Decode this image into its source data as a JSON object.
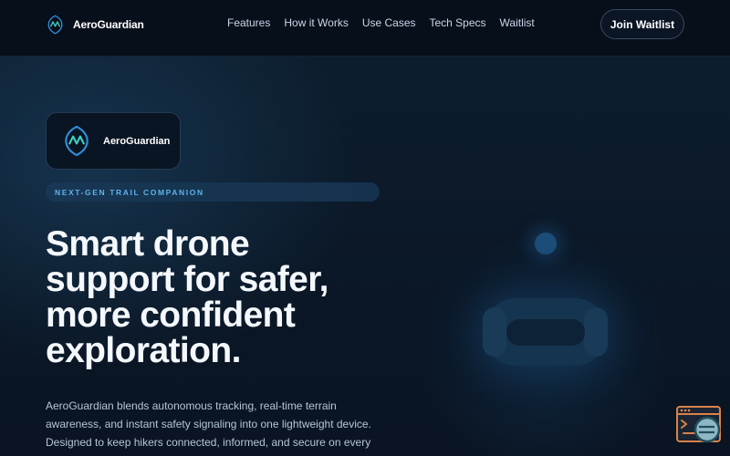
{
  "brand": {
    "name": "AeroGuardian",
    "logo_icon": "aeroguardian-logo-icon"
  },
  "nav": {
    "items": [
      {
        "label": "Features"
      },
      {
        "label": "How it Works"
      },
      {
        "label": "Use Cases"
      },
      {
        "label": "Tech Specs"
      },
      {
        "label": "Waitlist"
      }
    ],
    "cta_label": "Join Waitlist"
  },
  "hero": {
    "product_card_name": "AeroGuardian",
    "eyebrow": "NEXT-GEN TRAIL COMPANION",
    "headline": "Smart drone support for safer, more confident exploration.",
    "subtext": "AeroGuardian blends autonomous tracking, real-time terrain awareness, and instant safety signaling into one lightweight device. Designed to keep hikers connected, informed, and secure on every journey."
  },
  "colors": {
    "accent": "#5fb2ea",
    "background": "#0a1422",
    "logo_blue": "#2f8fd8",
    "logo_teal": "#3fd1c4"
  }
}
